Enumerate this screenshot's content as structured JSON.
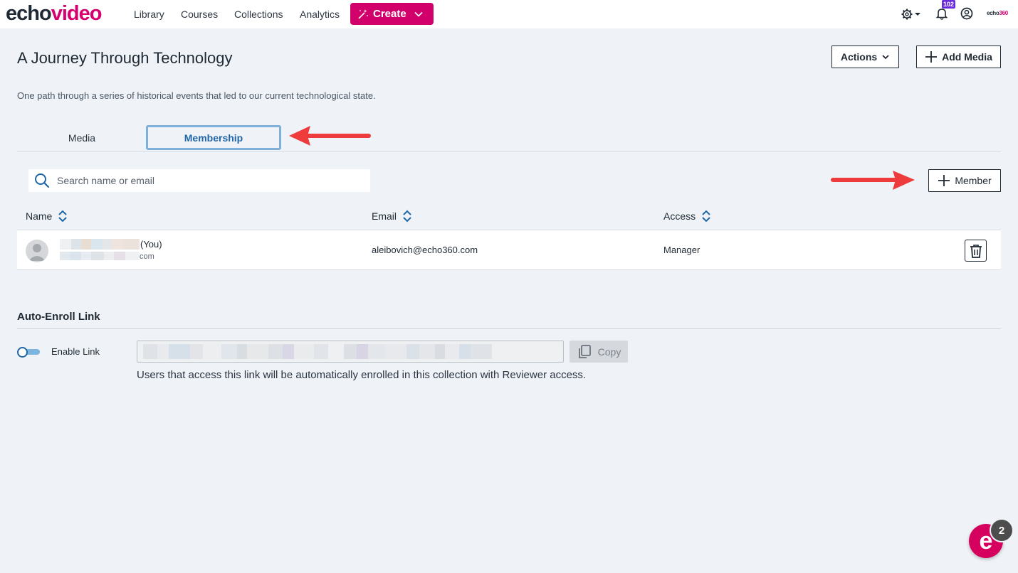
{
  "nav": {
    "logo_echo": "echo",
    "logo_video": "video",
    "links": [
      "Library",
      "Courses",
      "Collections",
      "Analytics"
    ],
    "create_label": "Create",
    "notification_count": "102",
    "brand_small_a": "echo",
    "brand_small_b": "360"
  },
  "page": {
    "title": "A Journey Through Technology",
    "description": "One path through a series of historical events that led to our current technological state.",
    "actions_label": "Actions",
    "add_media_label": "Add Media"
  },
  "tabs": [
    {
      "label": "Media",
      "active": false
    },
    {
      "label": "Membership",
      "active": true
    }
  ],
  "search": {
    "placeholder": "Search name or email"
  },
  "add_member_label": "Member",
  "table": {
    "columns": [
      "Name",
      "Email",
      "Access"
    ],
    "rows": [
      {
        "name_suffix": "(You)",
        "email_suffix": "com",
        "email": "aleibovich@echo360.com",
        "access": "Manager"
      }
    ]
  },
  "auto_enroll": {
    "title": "Auto-Enroll Link",
    "enable_label": "Enable Link",
    "enabled": false,
    "copy_label": "Copy",
    "helper": "Users that access this link will be automatically enrolled in this collection with Reviewer access."
  },
  "help_widget": {
    "count": "2",
    "letter": "e"
  },
  "colors": {
    "brand": "#d2006a",
    "accent": "#1f66a8",
    "annotation": "#ee3b3b"
  }
}
